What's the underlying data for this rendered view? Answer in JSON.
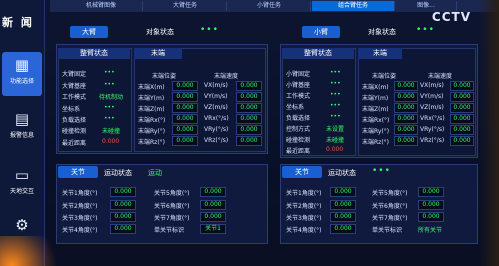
{
  "tabs": [
    "机械臂图像",
    "大臂任务",
    "小臂任务",
    "组合臂任务",
    "图像..."
  ],
  "active_tab": 3,
  "logo": "新 闻",
  "watermark": "CCTV",
  "sidebar": {
    "items": [
      {
        "label": "功能选择",
        "icon": "grid-icon"
      },
      {
        "label": "报警信息",
        "icon": "book-icon"
      },
      {
        "label": "天地交互",
        "icon": "chat-icon"
      },
      {
        "label": "",
        "icon": "gear-icon"
      }
    ]
  },
  "big_arm": {
    "title": "大臂",
    "object_state": "对象状态",
    "object_dots": "•••",
    "whole_title": "整臂状态",
    "end_title": "末端",
    "rows": [
      {
        "label": "大臂固定",
        "value": "•••"
      },
      {
        "label": "大臂基座",
        "value": "•••"
      },
      {
        "label": "工作模式",
        "value": "待机制动"
      },
      {
        "label": "坐标系",
        "value": "•••"
      },
      {
        "label": "负载选择",
        "value": "•••"
      },
      {
        "label": "碰撞检测",
        "value": "未碰撞"
      },
      {
        "label": "最近距离",
        "value": "0.000"
      }
    ],
    "end_pos_title": "末端位姿",
    "end_speed_title": "末端速度",
    "end_rows": [
      {
        "pl": "末端X(m)",
        "pv": "0.000",
        "sl": "VX(m/s)",
        "sv": "0.000"
      },
      {
        "pl": "末端Y(m)",
        "pv": "0.000",
        "sl": "VY(m/s)",
        "sv": "0.000"
      },
      {
        "pl": "末端Z(m)",
        "pv": "0.000",
        "sl": "VZ(m/s)",
        "sv": "0.000"
      },
      {
        "pl": "末端Rx(°)",
        "pv": "0.000",
        "sl": "VRx(°/s)",
        "sv": "0.000"
      },
      {
        "pl": "末端Ry(°)",
        "pv": "0.000",
        "sl": "VRy(°/s)",
        "sv": "0.000"
      },
      {
        "pl": "末端Rz(°)",
        "pv": "0.000",
        "sl": "VRz(°/s)",
        "sv": "0.000"
      }
    ],
    "joint_title": "关节",
    "motion_label": "运动状态",
    "motion_value": "运动",
    "joints": [
      {
        "l": "关节1角度(°)",
        "v": "0.000",
        "l2": "关节5角度(°)",
        "v2": "0.000"
      },
      {
        "l": "关节2角度(°)",
        "v": "0.000",
        "l2": "关节6角度(°)",
        "v2": "0.000"
      },
      {
        "l": "关节3角度(°)",
        "v": "0.000",
        "l2": "关节7角度(°)",
        "v2": "0.000"
      },
      {
        "l": "关节4角度(°)",
        "v": "0.000",
        "l2": "单关节标识",
        "v2": "关节1"
      }
    ]
  },
  "small_arm": {
    "title": "小臂",
    "object_state": "对象状态",
    "object_dots": "•••",
    "whole_title": "整臂状态",
    "end_title": "末端",
    "rows": [
      {
        "label": "小臂固定",
        "value": "•••"
      },
      {
        "label": "小臂基座",
        "value": "•••"
      },
      {
        "label": "工作模式",
        "value": "•••"
      },
      {
        "label": "坐标系",
        "value": "•••"
      },
      {
        "label": "负载选择",
        "value": "•••"
      },
      {
        "label": "控制方式",
        "value": "未设置"
      },
      {
        "label": "碰撞检测",
        "value": "未碰撞"
      },
      {
        "label": "最近距离",
        "value": "0.000"
      }
    ],
    "end_pos_title": "末端位姿",
    "end_speed_title": "末端速度",
    "end_rows": [
      {
        "pl": "末端X(m)",
        "pv": "0.000",
        "sl": "VX(m/s)",
        "sv": "0.000"
      },
      {
        "pl": "末端Y(m)",
        "pv": "0.000",
        "sl": "VY(m/s)",
        "sv": "0.000"
      },
      {
        "pl": "末端Z(m)",
        "pv": "0.000",
        "sl": "VZ(m/s)",
        "sv": "0.000"
      },
      {
        "pl": "末端Rx(°)",
        "pv": "0.000",
        "sl": "VRx(°/s)",
        "sv": "0.000"
      },
      {
        "pl": "末端Ry(°)",
        "pv": "0.000",
        "sl": "VRy(°/s)",
        "sv": "0.000"
      },
      {
        "pl": "末端Rz(°)",
        "pv": "0.000",
        "sl": "VRz(°/s)",
        "sv": "0.000"
      }
    ],
    "joint_title": "关节",
    "motion_label": "运动状态",
    "motion_value": "•••",
    "joints": [
      {
        "l": "关节1角度(°)",
        "v": "0.000",
        "l2": "关节5角度(°)",
        "v2": "0.000"
      },
      {
        "l": "关节2角度(°)",
        "v": "0.000",
        "l2": "关节6角度(°)",
        "v2": "0.000"
      },
      {
        "l": "关节3角度(°)",
        "v": "0.000",
        "l2": "关节7角度(°)",
        "v2": "0.000"
      },
      {
        "l": "关节4角度(°)",
        "v": "0.000",
        "l2": "单关节标识",
        "v2": "所有关节"
      }
    ]
  }
}
